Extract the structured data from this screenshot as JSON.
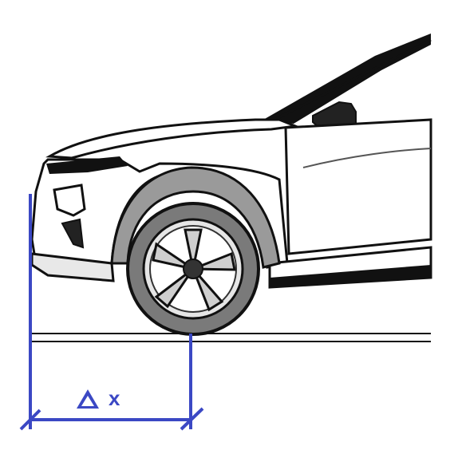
{
  "diagram": {
    "dimension_symbol": "Δ",
    "dimension_var": "x"
  },
  "colors": {
    "dimension": "#3b48c4",
    "outline": "#111111",
    "fender_fill": "#9a9a9a",
    "tire_fill": "#7a7a7a",
    "body_fill": "#ffffff"
  }
}
